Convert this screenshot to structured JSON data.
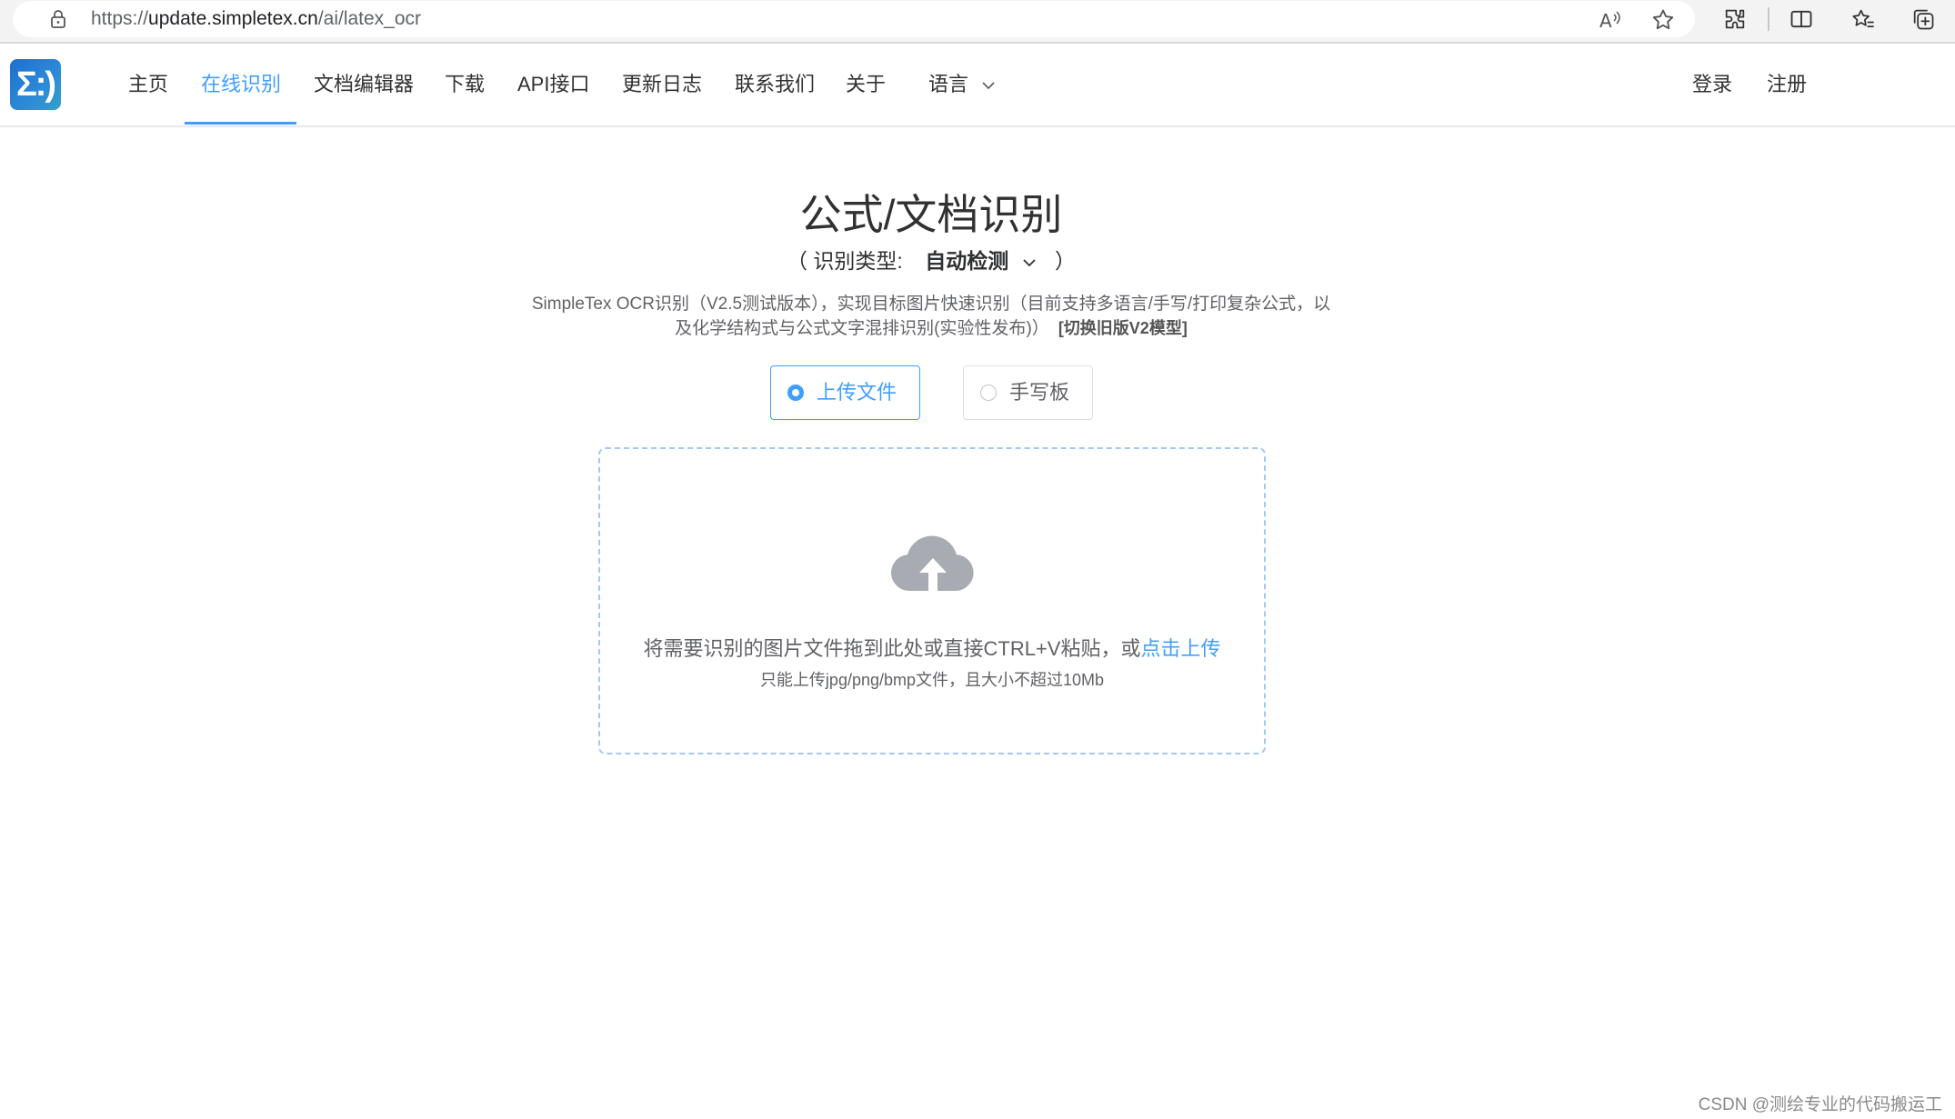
{
  "browser": {
    "url_prefix": "https://",
    "url_host": "update.simpletex.cn",
    "url_path": "/ai/latex_ocr",
    "icons": [
      "lock-icon",
      "read-aloud-icon",
      "favorite-star-icon",
      "extensions-icon",
      "split-screen-icon",
      "favorites-icon",
      "collections-icon"
    ]
  },
  "header": {
    "logo_text": "Σ:)",
    "nav": [
      {
        "label": "主页"
      },
      {
        "label": "在线识别",
        "active": true
      },
      {
        "label": "文档编辑器"
      },
      {
        "label": "下载"
      },
      {
        "label": "API接口"
      },
      {
        "label": "更新日志"
      },
      {
        "label": "联系我们"
      },
      {
        "label": "关于"
      },
      {
        "label": "语言"
      }
    ],
    "login": "登录",
    "register": "注册"
  },
  "main": {
    "title": "公式/文档识别",
    "ocr_type_prefix": "（ 识别类型:",
    "ocr_type_value": "自动检测",
    "ocr_type_suffix": "）",
    "desc_line1": "SimpleTex OCR识别（V2.5测试版本），实现目标图片快速识别（目前支持多语言/手写/打印复杂公式，以",
    "desc_line2": "及化学结构式与公式文字混排识别(实验性发布)）",
    "switch_link": "[切换旧版V2模型]",
    "modes": [
      {
        "label": "上传文件",
        "selected": true
      },
      {
        "label": "手写板",
        "selected": false
      }
    ],
    "drop_text": "将需要识别的图片文件拖到此处或直接CTRL+V粘贴，或",
    "drop_link": "点击上传",
    "drop_tip": "只能上传jpg/png/bmp文件，且大小不超过10Mb"
  },
  "watermark": "CSDN @测绘专业的代码搬运工",
  "colors": {
    "accent": "#409eff",
    "text": "#303133",
    "muted": "#606266",
    "icon_gray": "#a8abb2"
  }
}
